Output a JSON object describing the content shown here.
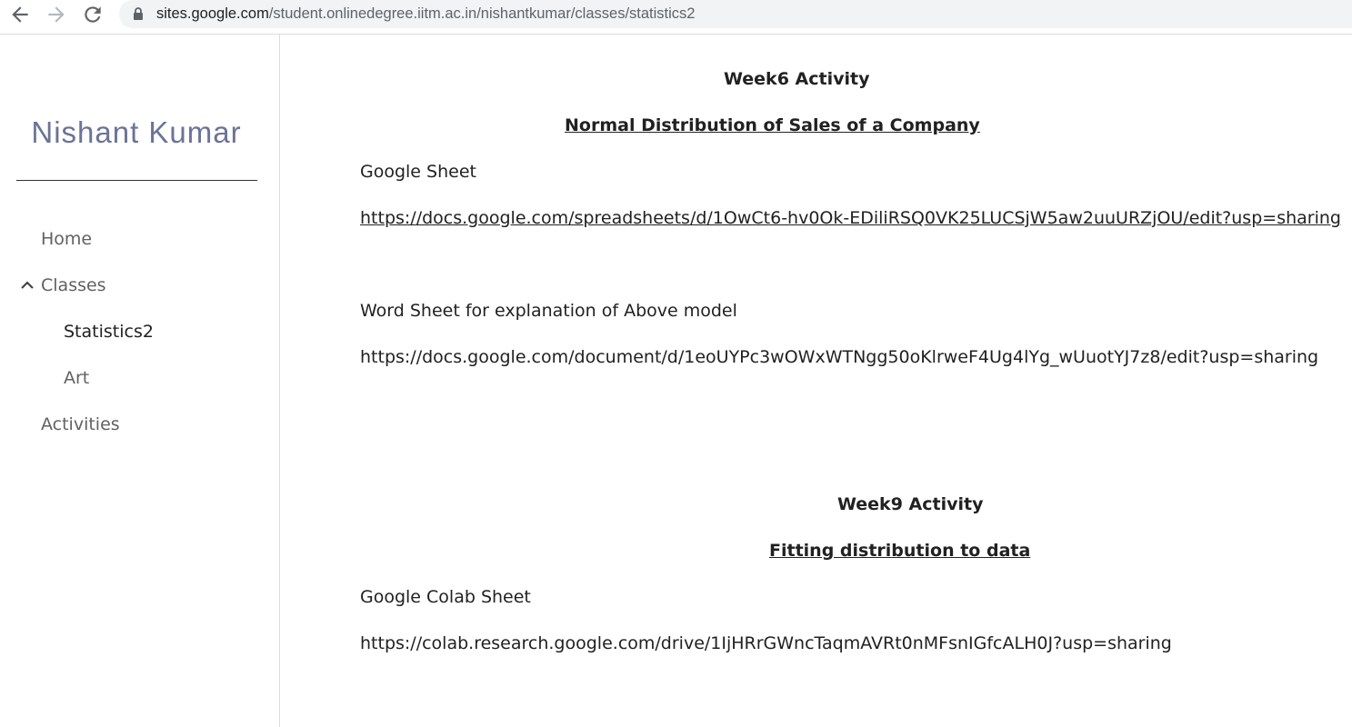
{
  "browser": {
    "url_host": "sites.google.com",
    "url_path": "/student.onlinedegree.iitm.ac.in/nishantkumar/classes/statistics2"
  },
  "sidebar": {
    "site_title": "Nishant Kumar",
    "items": [
      {
        "label": "Home"
      },
      {
        "label": "Classes"
      },
      {
        "label": "Statistics2"
      },
      {
        "label": "Art"
      },
      {
        "label": "Activities"
      }
    ]
  },
  "main": {
    "week6": {
      "heading": "Week6 Activity",
      "subheading": "Normal Distribution of Sales of a Company",
      "sheet_label": "Google Sheet",
      "sheet_link": "https://docs.google.com/spreadsheets/d/1OwCt6-hv0Ok-EDiliRSQ0VK25LUCSjW5aw2uuURZjOU/edit?usp=sharing",
      "word_label": "Word Sheet for explanation of Above model",
      "word_link": "https://docs.google.com/document/d/1eoUYPc3wOWxWTNgg50oKlrweF4Ug4lYg_wUuotYJ7z8/edit?usp=sharing"
    },
    "week9": {
      "heading": "Week9 Activity",
      "subheading": "Fitting distribution to data",
      "colab_label": "Google Colab Sheet",
      "colab_link": "https://colab.research.google.com/drive/1IjHRrGWncTaqmAVRt0nMFsnIGfcALH0J?usp=sharing"
    }
  }
}
